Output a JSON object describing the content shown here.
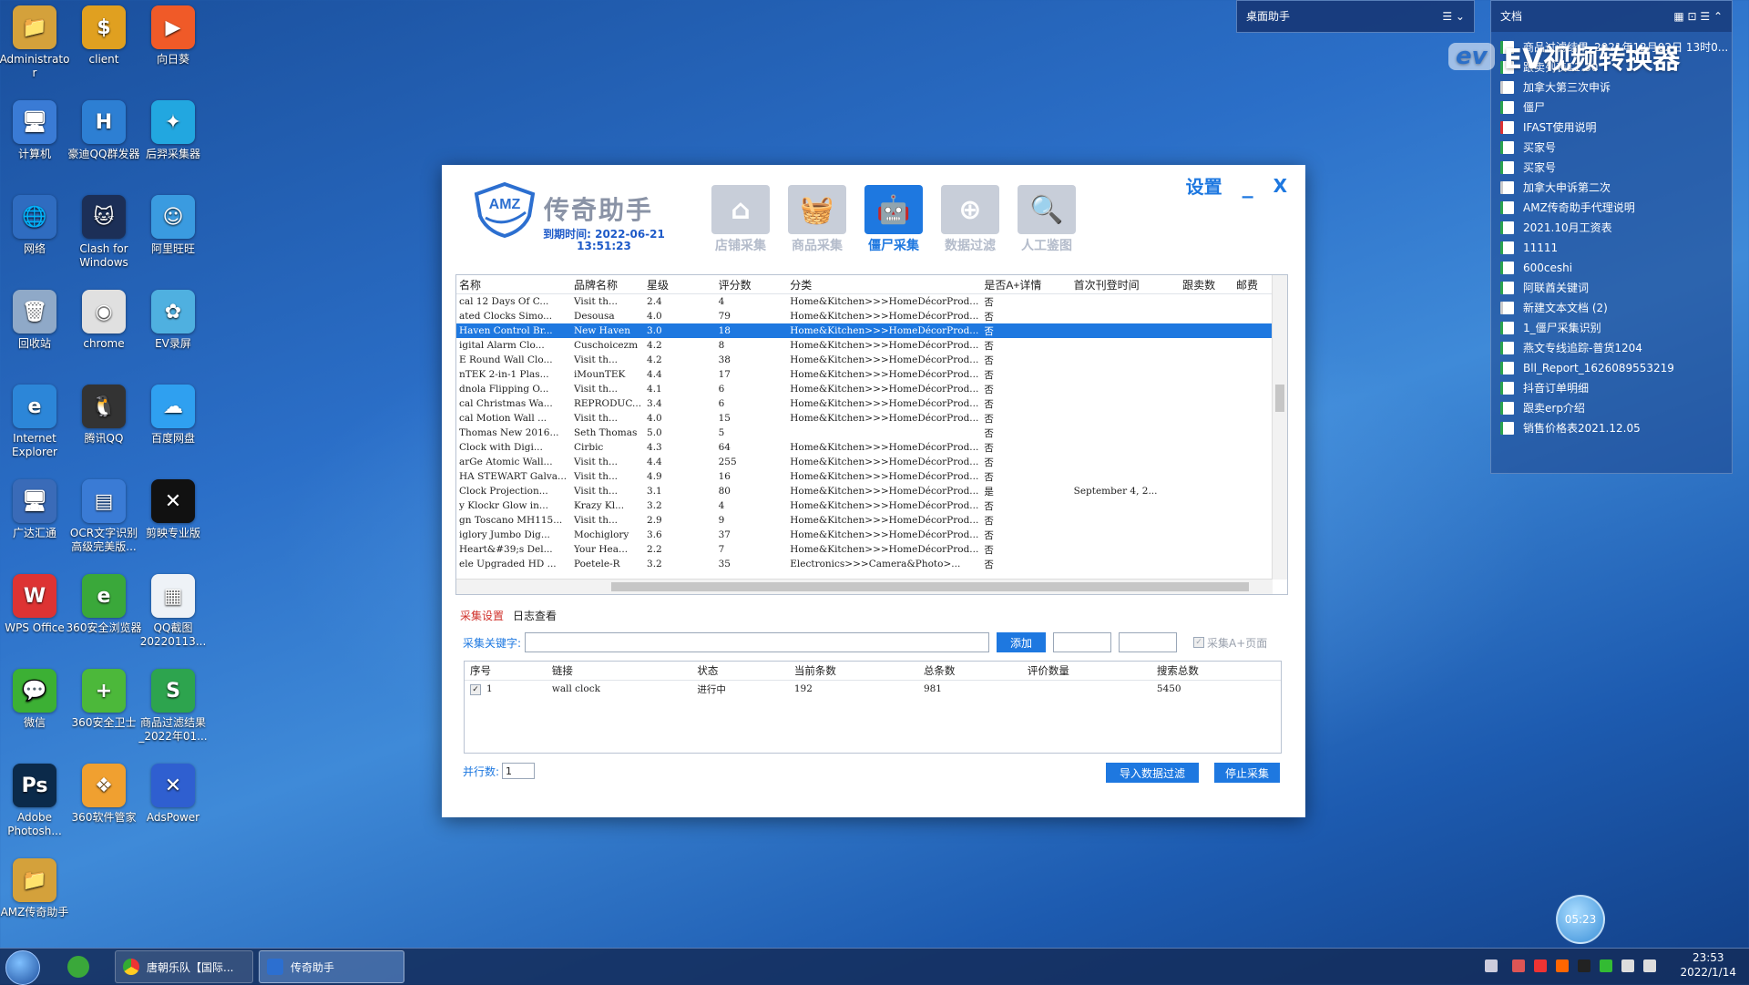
{
  "desktop_icons": [
    {
      "label": "Administrato\nr",
      "color": "#d4a13b",
      "glyph": "📁"
    },
    {
      "label": "client",
      "color": "#e0a020",
      "glyph": "$"
    },
    {
      "label": "向日葵",
      "color": "#f05a28",
      "glyph": "▶"
    },
    {
      "label": "计算机",
      "color": "#3a7bd5",
      "glyph": "🖥"
    },
    {
      "label": "豪迪QQ群发器",
      "color": "#2d7fd3",
      "glyph": "H"
    },
    {
      "label": "后羿采集器",
      "color": "#22a7e0",
      "glyph": "✦"
    },
    {
      "label": "网络",
      "color": "#2f6cc0",
      "glyph": "🌐"
    },
    {
      "label": "Clash for Windows",
      "color": "#1c2f57",
      "glyph": "🐱"
    },
    {
      "label": "阿里旺旺",
      "color": "#3a9be0",
      "glyph": "☺"
    },
    {
      "label": "回收站",
      "color": "#8fa9c8",
      "glyph": "🗑"
    },
    {
      "label": "chrome",
      "color": "#e0e0e0",
      "glyph": "◉"
    },
    {
      "label": "EV录屏",
      "color": "#4fb0e0",
      "glyph": "✿"
    },
    {
      "label": "Internet Explorer",
      "color": "#2c86d8",
      "glyph": "e"
    },
    {
      "label": "腾讯QQ",
      "color": "#333",
      "glyph": "🐧"
    },
    {
      "label": "百度网盘",
      "color": "#2fa0f0",
      "glyph": "☁"
    },
    {
      "label": "广达汇通",
      "color": "#3a6bb8",
      "glyph": "🖥"
    },
    {
      "label": "OCR文字识别高级完美版...",
      "color": "#3a7bd5",
      "glyph": "▤"
    },
    {
      "label": "剪映专业版",
      "color": "#111",
      "glyph": "✕"
    },
    {
      "label": "WPS Office",
      "color": "#d33",
      "glyph": "W"
    },
    {
      "label": "360安全浏览器",
      "color": "#3aa83a",
      "glyph": "e"
    },
    {
      "label": "QQ截图20220113...",
      "color": "#eef2f7",
      "glyph": "▦"
    },
    {
      "label": "微信",
      "color": "#3cb034",
      "glyph": "💬"
    },
    {
      "label": "360安全卫士",
      "color": "#4cb83a",
      "glyph": "+"
    },
    {
      "label": "商品过滤结果_2022年01...",
      "color": "#2da44e",
      "glyph": "S"
    },
    {
      "label": "Adobe Photosh...",
      "color": "#0b2a4a",
      "glyph": "Ps"
    },
    {
      "label": "360软件管家",
      "color": "#f0a030",
      "glyph": "❖"
    },
    {
      "label": "AdsPower",
      "color": "#2f5fd0",
      "glyph": "✕"
    },
    {
      "label": "AMZ传奇助手",
      "color": "#d4a13b",
      "glyph": "📁"
    }
  ],
  "desk_helper": {
    "title": "桌面助手"
  },
  "docs_panel": {
    "title": "文档",
    "items": [
      {
        "name": "商品过滤结果_2021年12月02日 13时0...",
        "type": "x"
      },
      {
        "name": "跟卖列表11.30",
        "type": "x"
      },
      {
        "name": "加拿大第三次申诉",
        "type": "w"
      },
      {
        "name": "僵尸",
        "type": "x"
      },
      {
        "name": "IFAST使用说明",
        "type": "r"
      },
      {
        "name": "买家号",
        "type": "x"
      },
      {
        "name": "买家号",
        "type": "x"
      },
      {
        "name": "加拿大申诉第二次",
        "type": "w"
      },
      {
        "name": "AMZ传奇助手代理说明",
        "type": "x"
      },
      {
        "name": "2021.10月工资表",
        "type": "x"
      },
      {
        "name": "11111",
        "type": "x"
      },
      {
        "name": "600ceshi",
        "type": "x"
      },
      {
        "name": "阿联酋关键词",
        "type": "x"
      },
      {
        "name": "新建文本文档 (2)",
        "type": "w"
      },
      {
        "name": "1_僵尸采集识别",
        "type": "x"
      },
      {
        "name": "燕文专线追踪-普货1204",
        "type": "x"
      },
      {
        "name": "Bll_Report_1626089553219",
        "type": "x"
      },
      {
        "name": "抖音订单明细",
        "type": "x"
      },
      {
        "name": "跟卖erp介绍",
        "type": "x"
      },
      {
        "name": "销售价格表2021.12.05",
        "type": "x"
      }
    ]
  },
  "watermark": {
    "logo": "ev",
    "text": "EV视频转换器"
  },
  "app": {
    "brand": {
      "logo_text": "AMZ",
      "title": "传奇助手",
      "expiry_line1": "到期时间: 2022-06-21",
      "expiry_line2": "13:51:23"
    },
    "top_controls": {
      "settings": "设置",
      "minimize": "_",
      "close": "X"
    },
    "nav": [
      {
        "label": "店铺采集",
        "icon": "shop-icon",
        "active": false
      },
      {
        "label": "商品采集",
        "icon": "basket-icon",
        "active": false
      },
      {
        "label": "僵尸采集",
        "icon": "robot-icon",
        "active": true
      },
      {
        "label": "数据过滤",
        "icon": "target-icon",
        "active": false
      },
      {
        "label": "人工鉴图",
        "icon": "magnifier-icon",
        "active": false
      }
    ],
    "grid": {
      "columns": [
        "名称",
        "品牌名称",
        "星级",
        "评分数",
        "分类",
        "是否A+详情",
        "首次刊登时间",
        "跟卖数",
        "邮费"
      ],
      "selected_index": 2,
      "rows": [
        [
          "cal 12 Days Of C...",
          "Visit th...",
          "2.4",
          "4",
          "Home&Kitchen>>>HomeDécorProd...",
          "否",
          "",
          "",
          ""
        ],
        [
          "ated Clocks Simo...",
          "Desousa",
          "4.0",
          "79",
          "Home&Kitchen>>>HomeDécorProd...",
          "否",
          "",
          "",
          ""
        ],
        [
          "Haven Control Br...",
          "New Haven",
          "3.0",
          "18",
          "Home&Kitchen>>>HomeDécorProd...",
          "否",
          "",
          "",
          ""
        ],
        [
          "igital Alarm Clo...",
          "Cuschoicezm",
          "4.2",
          "8",
          "Home&Kitchen>>>HomeDécorProd...",
          "否",
          "",
          "",
          ""
        ],
        [
          "E Round Wall Clo...",
          "Visit th...",
          "4.2",
          "38",
          "Home&Kitchen>>>HomeDécorProd...",
          "否",
          "",
          "",
          ""
        ],
        [
          "nTEK 2-in-1 Plas...",
          "iMounTEK",
          "4.4",
          "17",
          "Home&Kitchen>>>HomeDécorProd...",
          "否",
          "",
          "",
          ""
        ],
        [
          "dnola Flipping O...",
          "Visit th...",
          "4.1",
          "6",
          "Home&Kitchen>>>HomeDécorProd...",
          "否",
          "",
          "",
          ""
        ],
        [
          "cal Christmas Wa...",
          "REPRODUC...",
          "3.4",
          "6",
          "Home&Kitchen>>>HomeDécorProd...",
          "否",
          "",
          "",
          ""
        ],
        [
          "cal Motion Wall ...",
          "Visit th...",
          "4.0",
          "15",
          "Home&Kitchen>>>HomeDécorProd...",
          "否",
          "",
          "",
          ""
        ],
        [
          "Thomas New 2016...",
          "Seth Thomas",
          "5.0",
          "5",
          "",
          "否",
          "",
          "",
          ""
        ],
        [
          " Clock with Digi...",
          "Cirbic",
          "4.3",
          "64",
          "Home&Kitchen>>>HomeDécorProd...",
          "否",
          "",
          "",
          ""
        ],
        [
          "arGe Atomic Wall...",
          "Visit th...",
          "4.4",
          "255",
          "Home&Kitchen>>>HomeDécorProd...",
          "否",
          "",
          "",
          ""
        ],
        [
          "HA STEWART Galva...",
          "Visit th...",
          "4.9",
          "16",
          "Home&Kitchen>>>HomeDécorProd...",
          "否",
          "",
          "",
          ""
        ],
        [
          "Clock Projection...",
          "Visit th...",
          "3.1",
          "80",
          "Home&Kitchen>>>HomeDécorProd...",
          "是",
          "September 4, 2...",
          "",
          ""
        ],
        [
          "y Klockr Glow in...",
          "Krazy Kl...",
          "3.2",
          "4",
          "Home&Kitchen>>>HomeDécorProd...",
          "否",
          "",
          "",
          ""
        ],
        [
          "gn Toscano MH115...",
          "Visit th...",
          "2.9",
          "9",
          "Home&Kitchen>>>HomeDécorProd...",
          "否",
          "",
          "",
          ""
        ],
        [
          "iglory Jumbo Dig...",
          "Mochiglory",
          "3.6",
          "37",
          "Home&Kitchen>>>HomeDécorProd...",
          "否",
          "",
          "",
          ""
        ],
        [
          " Heart&#39;s Del...",
          "Your Hea...",
          "2.2",
          "7",
          "Home&Kitchen>>>HomeDécorProd...",
          "否",
          "",
          "",
          ""
        ],
        [
          "ele Upgraded HD ...",
          "Poetele-R",
          "3.2",
          "35",
          "Electronics>>>Camera&Photo>...",
          "否",
          "",
          "",
          ""
        ]
      ]
    },
    "tabs": [
      {
        "label": "采集设置",
        "active": true
      },
      {
        "label": "日志查看",
        "active": false
      }
    ],
    "keyword": {
      "label": "采集关键字:",
      "value": "",
      "add_button": "添加",
      "aplus_label": "采集A+页面"
    },
    "task_table": {
      "columns": [
        "序号",
        "链接",
        "状态",
        "当前条数",
        "总条数",
        "评价数量",
        "搜索总数"
      ],
      "rows": [
        {
          "checked": "✓",
          "index": "1",
          "link": "wall clock",
          "status": "进行中",
          "current": "192",
          "total": "981",
          "reviews": "",
          "search_total": "5450"
        }
      ]
    },
    "concurrency": {
      "label": "并行数:",
      "value": "1"
    },
    "buttons": {
      "import": "导入数据过滤",
      "stop": "停止采集"
    }
  },
  "taskbar": {
    "items": [
      {
        "label": "唐朝乐队【国际..."
      },
      {
        "label": "传奇助手"
      }
    ],
    "time": "23:53",
    "date": "2022/1/14",
    "recorder": "05:23"
  }
}
